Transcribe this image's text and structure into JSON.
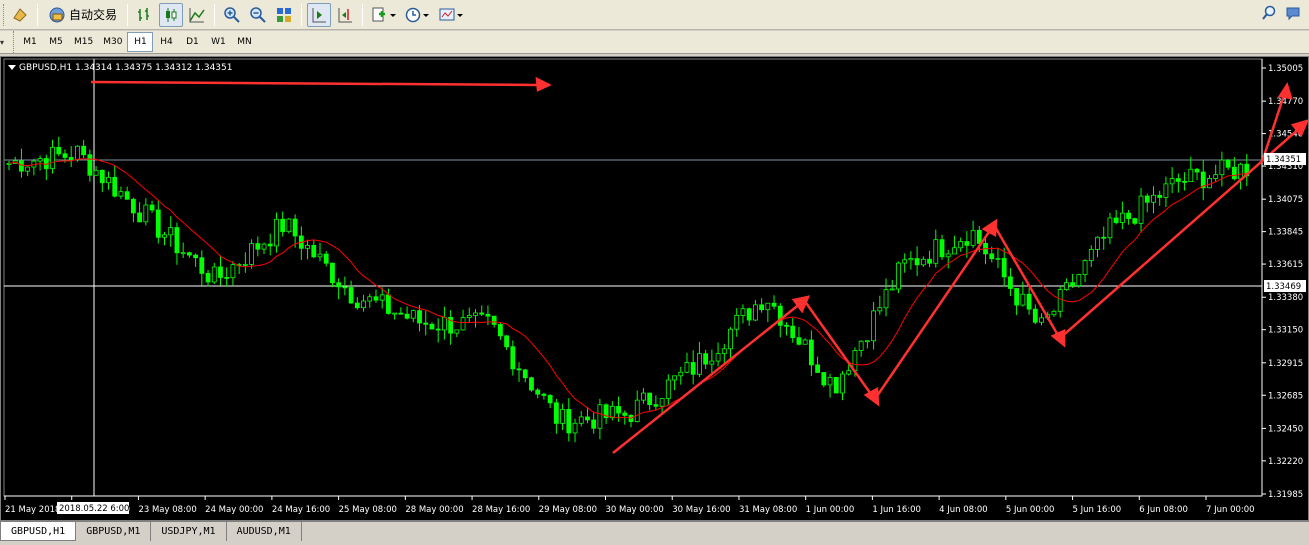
{
  "toolbar": {
    "auto_trading_label": "自动交易"
  },
  "timeframes": [
    "M1",
    "M5",
    "M15",
    "M30",
    "H1",
    "H4",
    "D1",
    "W1",
    "MN"
  ],
  "active_timeframe": "H1",
  "chart": {
    "header": "GBPUSD,H1  1.34314 1.34375 1.34312 1.34351",
    "price_labels": [
      "1.35005",
      "1.34770",
      "1.34540",
      "1.34310",
      "1.34075",
      "1.33845",
      "1.33615",
      "1.33380",
      "1.33150",
      "1.32915",
      "1.32685",
      "1.32450",
      "1.32220",
      "1.31985"
    ],
    "current_price_tag": "1.34351",
    "crosshair_price_tag": "1.33469",
    "crosshair_time_tag": "2018.05.22 6:00",
    "time_labels": [
      "21 May 2018",
      "22 May 16:00",
      "23 May 08:00",
      "24 May 00:00",
      "24 May 16:00",
      "25 May 08:00",
      "28 May 00:00",
      "28 May 16:00",
      "29 May 08:00",
      "30 May 00:00",
      "30 May 16:00",
      "31 May 08:00",
      "1 Jun 00:00",
      "1 Jun 16:00",
      "4 Jun 08:00",
      "5 Jun 00:00",
      "5 Jun 16:00",
      "6 Jun 08:00",
      "7 Jun 00:00"
    ],
    "colors": {
      "background": "#000000",
      "bull": "#00ff00",
      "bear": "#00ff00",
      "ma": "#ff0000",
      "arrows": "#ff3030",
      "grid_text": "#ffffff"
    }
  },
  "chart_data": {
    "type": "line",
    "title": "GBPUSD,H1",
    "series": [
      {
        "name": "",
        "x": [
          "21 May 2018",
          "22 May 16:00",
          "23 May 08:00",
          "24 May 00:00",
          "24 May 16:00",
          "25 May 08:00",
          "28 May 00:00",
          "28 May 16:00",
          "29 May 08:00",
          "30 May 00:00",
          "30 May 16:00",
          "31 May 08:00",
          "1 Jun 00:00",
          "1 Jun 16:00",
          "4 Jun 08:00",
          "5 Jun 00:00",
          "5 Jun 16:00",
          "6 Jun 08:00",
          "7 Jun 00:00"
        ],
        "values": [
          1.3433,
          1.344,
          1.3395,
          1.335,
          1.339,
          1.334,
          1.332,
          1.3318,
          1.325,
          1.3255,
          1.329,
          1.334,
          1.3275,
          1.336,
          1.3385,
          1.3315,
          1.3385,
          1.342,
          1.343
        ]
      }
    ],
    "ylim": [
      1.31985,
      1.35005
    ]
  },
  "tabs": [
    "GBPUSD,H1",
    "GBPUSD,M1",
    "USDJPY,M1",
    "AUDUSD,M1"
  ],
  "active_tab": "GBPUSD,H1"
}
